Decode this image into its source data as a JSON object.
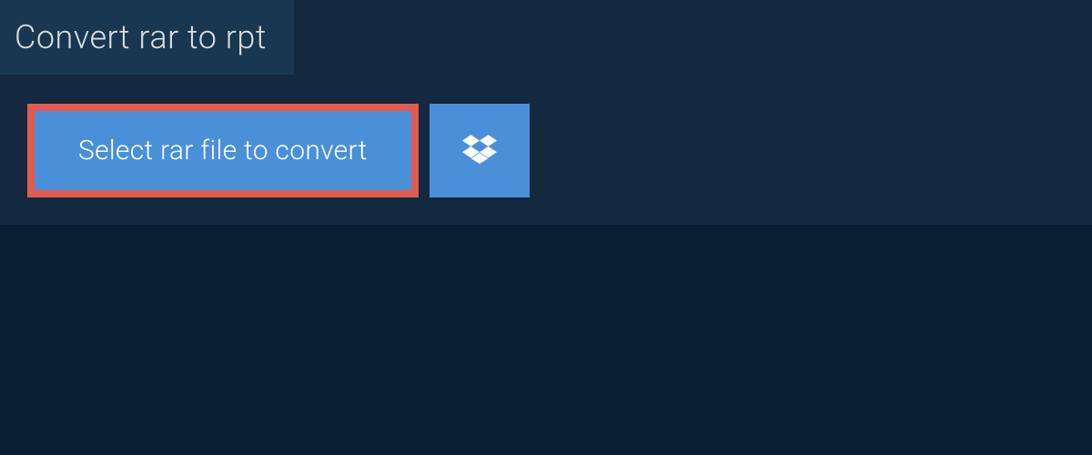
{
  "header": {
    "title": "Convert rar to rpt"
  },
  "actions": {
    "select_file_label": "Select rar file to convert",
    "dropbox_icon": "dropbox-icon"
  },
  "colors": {
    "background": "#0a1f33",
    "panel": "#12293f",
    "header_tab": "#193750",
    "button": "#4a90d9",
    "button_border": "#e35a4f",
    "text_light": "#d8dde2"
  }
}
